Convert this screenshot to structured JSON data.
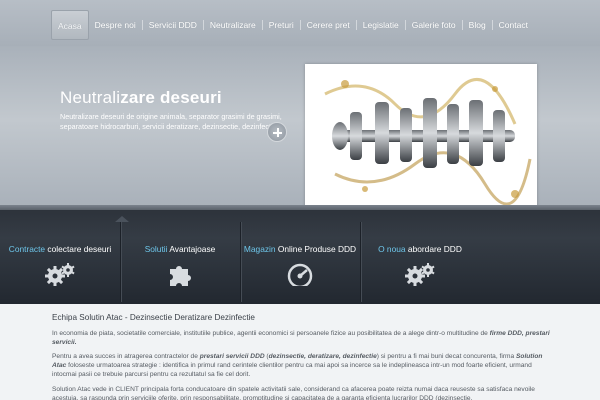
{
  "nav": {
    "items": [
      "Acasa",
      "Despre noi",
      "Servicii DDD",
      "Neutralizare",
      "Preturi",
      "Cerere pret",
      "Legislatie",
      "Galerie foto",
      "Blog",
      "Contact"
    ],
    "active": "Acasa"
  },
  "hero": {
    "title_light": "Neutrali",
    "title_mid": "zare",
    "title_bold": "deseuri",
    "description": "Neutralizare deseuri de origine animala, separator grasimi de grasimi, separatoare hidrocarburi, servicii deratizare, dezinsectie, dezinfectie."
  },
  "features": [
    {
      "highlight": "Contracte",
      "rest": " colectare deseuri",
      "icon": "gears-icon"
    },
    {
      "highlight": "Solutii",
      "rest": " Avantajoase",
      "icon": "puzzle-icon"
    },
    {
      "highlight": "Magazin",
      "rest": " Online Produse DDD",
      "icon": "speedometer-icon"
    },
    {
      "highlight": "O noua",
      "rest": " abordare DDD",
      "icon": "gears-icon"
    }
  ],
  "content": {
    "title": "Echipa Solutin Atac - Dezinsectie Deratizare Dezinfectie",
    "p1_a": "In economia de piata, societatile comerciale, institutiile publice, agentii economici si persoanele fizice au posibilitatea de a alege dintr-o multitudine de ",
    "p1_b": "firme DDD, prestari servicii.",
    "p2_a": "Pentru a avea succes in atragerea contractelor de ",
    "p2_b": "prestari servicii DDD",
    "p2_c": " (",
    "p2_d": "dezinsectie, deratizare, dezinfectie",
    "p2_e": ") si pentru a fi mai buni decat concurenta, firma ",
    "p2_f": "Solution Atac",
    "p2_g": " foloseste urmatoarea strategie : identifica in primul rand cerintele clientilor pentru ca mai apoi sa incerce sa le indeplineasca intr-un mod foarte eficient, urmand intocmai pasii ce trebuie parcursi pentru ca rezultatul sa fie cel dorit.",
    "p3": "Solution Atac vede in CLIENT principala forta conducatoare din spatele activitatii sale, considerand ca afacerea poate reizta numai daca reuseste sa satisfaca nevoile acestuia, sa raspunda prin serviciile oferite, prin responsabilitate, promptitudine si capacitatea de a garanta eficienta lucrarilor DDD (dezinsectie,"
  }
}
